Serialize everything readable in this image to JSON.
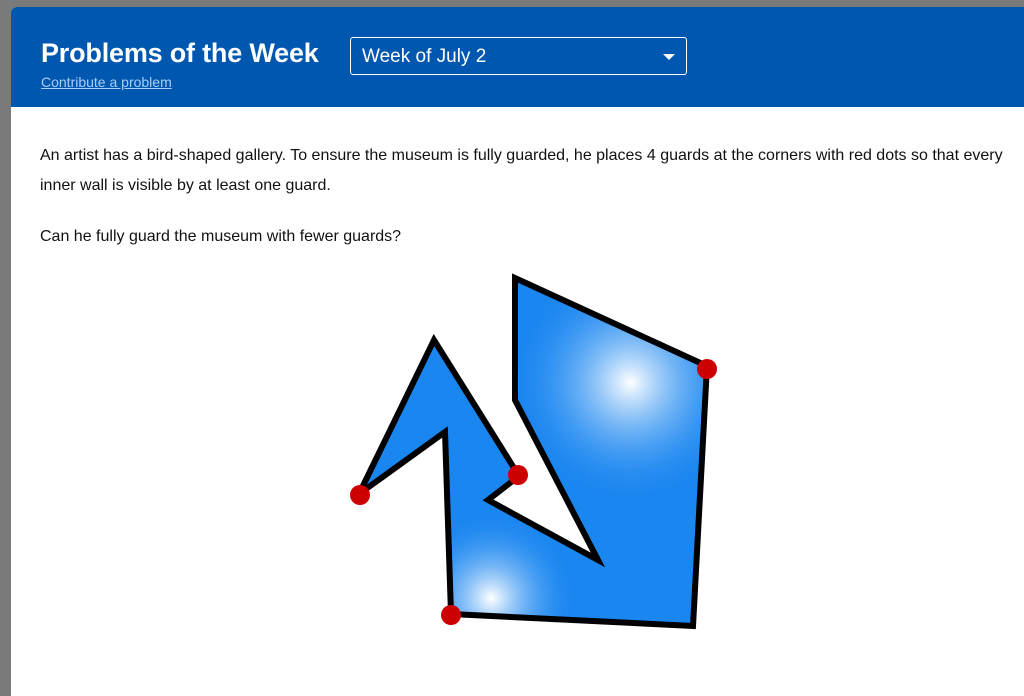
{
  "header": {
    "title": "Problems of the Week",
    "contribute_link": "Contribute a problem",
    "week_select": {
      "selected": "Week of July 2"
    }
  },
  "problem": {
    "statement": "An artist has a bird-shaped gallery. To ensure the museum is fully guarded, he places 4 guards at the corners with red dots so that every inner wall is visible by at least one guard.",
    "question": "Can he fully guard the museum with fewer guards?"
  },
  "colors": {
    "header_bg": "#0057b0",
    "gallery_fill": "#1a86f0",
    "guard_dot": "#cc0000"
  },
  "icons": {
    "dropdown": "chevron-down-icon"
  }
}
